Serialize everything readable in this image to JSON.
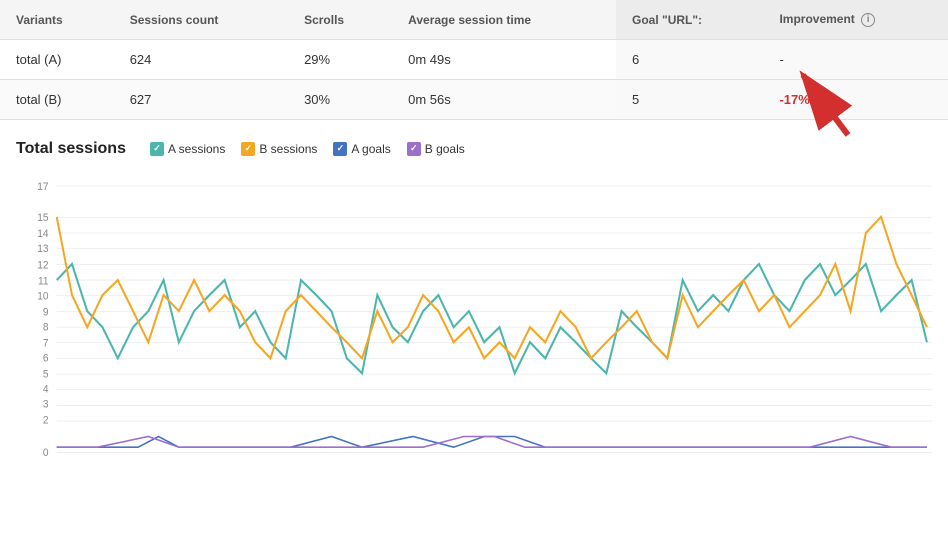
{
  "table": {
    "headers": [
      "Variants",
      "Sessions count",
      "Scrolls",
      "Average session time",
      "Goal \"URL\":",
      "Improvement"
    ],
    "rows": [
      {
        "variant": "total (A)",
        "sessions_count": "624",
        "scrolls": "29%",
        "avg_session_time": "0m 49s",
        "goal_url": "6",
        "improvement": "-"
      },
      {
        "variant": "total (B)",
        "sessions_count": "627",
        "scrolls": "30%",
        "avg_session_time": "0m 56s",
        "goal_url": "5",
        "improvement": "-17%"
      }
    ]
  },
  "chart": {
    "title": "Total sessions",
    "legend": [
      {
        "label": "A sessions",
        "color": "#4db6ac",
        "check_bg": "#4db6ac"
      },
      {
        "label": "B sessions",
        "color": "#f5a623",
        "check_bg": "#f5a623"
      },
      {
        "label": "A goals",
        "color": "#4472c4",
        "check_bg": "#4472c4"
      },
      {
        "label": "B goals",
        "color": "#9c6fcb",
        "check_bg": "#9c6fcb"
      }
    ],
    "y_labels": [
      "0",
      "2",
      "3",
      "4",
      "5",
      "6",
      "7",
      "8",
      "9",
      "10",
      "11",
      "12",
      "13",
      "14",
      "15",
      "17"
    ],
    "info_icon_label": "i"
  }
}
